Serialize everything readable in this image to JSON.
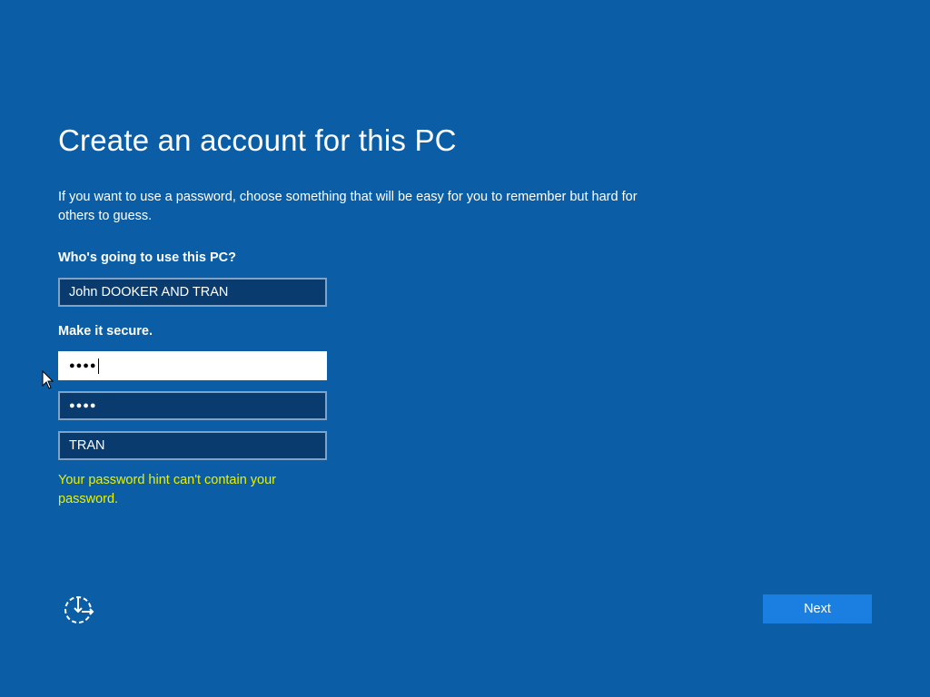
{
  "page": {
    "title": "Create an account for this PC",
    "intro": "If you want to use a password, choose something that will be easy for you to remember but hard for others to guess."
  },
  "form": {
    "username_label": "Who's going to use this PC?",
    "username_value": "John DOOKER AND TRAN",
    "secure_label": "Make it secure.",
    "password_mask": "●●●●",
    "confirm_mask": "●●●●",
    "hint_value": "TRAN",
    "error_text": "Your password hint can't contain your password."
  },
  "footer": {
    "accessibility_icon": "ease-of-access-icon",
    "next_label": "Next"
  },
  "colors": {
    "background": "#0b5ea6",
    "field_background": "#0a3b6e",
    "error": "#e8f000",
    "next_button": "#1a7fe0"
  }
}
